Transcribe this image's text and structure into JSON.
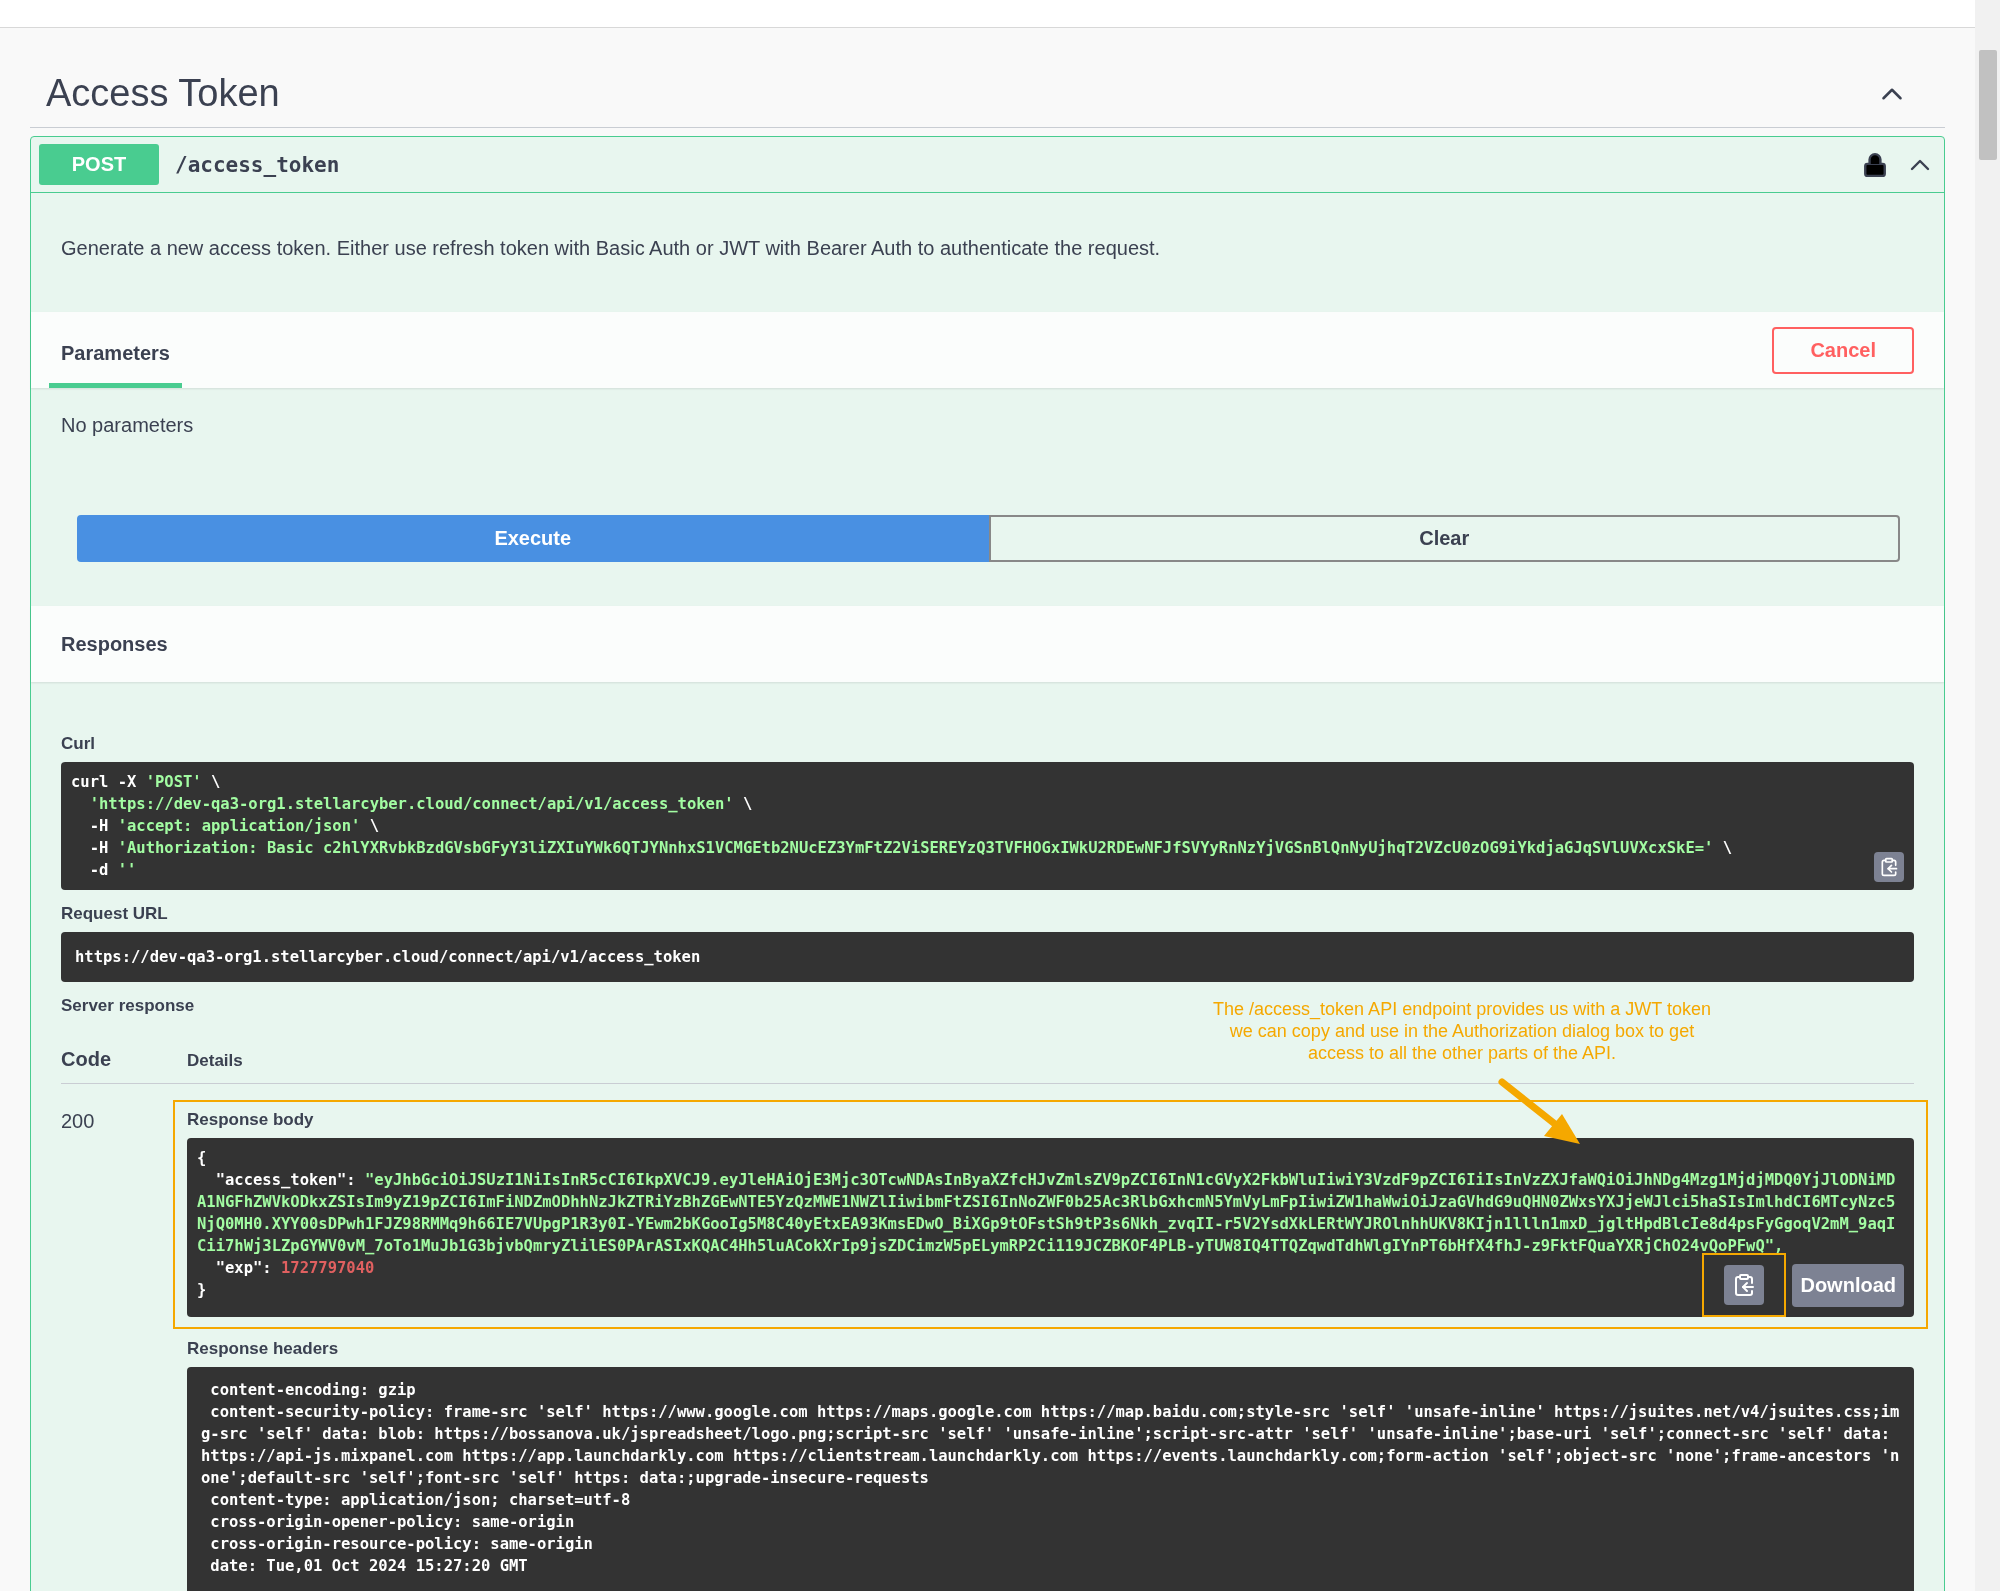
{
  "section": {
    "title": "Access Token",
    "expanded": true
  },
  "operation": {
    "method": "POST",
    "path": "/access_token",
    "locked": true,
    "expanded": true,
    "description": "Generate a new access token. Either use refresh token with Basic Auth or JWT with Bearer Auth to authenticate the request."
  },
  "parameters": {
    "tab": "Parameters",
    "tab_selected": true,
    "cancel": "Cancel",
    "empty_text": "No parameters"
  },
  "actions": [
    {
      "label": "Execute",
      "kind": "primary"
    },
    {
      "label": "Clear",
      "kind": "secondary"
    }
  ],
  "responses": {
    "title": "Responses",
    "curl_label": "Curl",
    "curl_lines": [
      "curl -X 'POST' \\",
      "  'https://dev-qa3-org1.stellarcyber.cloud/connect/api/v1/access_token' \\",
      "  -H 'accept: application/json' \\",
      "  -H 'Authorization: Basic c2hlYXRvbkBzdGVsbGFyY3liZXIuYWk6QTJYNnhxS1VCMGEtb2NUcEZ3YmFtZ2ViSEREYzQ3TVFHOGxIWkU2RDEwNFJfSVYyRnNzYjVGSnBlQnNyUjhqT2VZcU0zOG9iYkdjaGJqSVlUVXcxSkE=' \\",
      "  -d ''"
    ],
    "request_url_label": "Request URL",
    "request_url": "https://dev-qa3-org1.stellarcyber.cloud/connect/api/v1/access_token",
    "server_response_label": "Server response",
    "columns": [
      "Code",
      "Details"
    ],
    "code": "200",
    "body_label": "Response body",
    "body_lines": [
      "{",
      "  \"access_token\": \"eyJhbGciOiJSUzI1NiIsInR5cCI6IkpXVCJ9.eyJleHAiOjE3Mjc3OTcwNDAsInByaXZfcHJvZmlsZV9pZCI6InN1cGVyX2FkbWluIiwiY3VzdF9pZCI6IiIsInVzZXJfaWQiOiJhNDg4Mzg1MjdjMDQ0YjJlODNiMDA1NGFhZWVkODkxZSIsIm9yZ19pZCI6ImFiNDZmODhhNzJkZTRiYzBhZGEwNTE5YzQzMWE1NWZlIiwibmFtZSI6InNoZWF0b25Ac3RlbGxhcmN5YmVyLmFpIiwiZW1haWwiOiJzaGVhdG9uQHN0ZWxsYXJjeWJlci5haSIsImlhdCI6MTcyNzc5NjQ0MH0.XYY00sDPwh1FJZ98RMMq9h66IE7VUpgP1R3y0I-YEwm2bKGooIg5M8C40yEtxEA93KmsEDwO_BiXGp9tOFstSh9tP3s6Nkh_zvqII-r5V2YsdXkLERtWYJROlnhhUKV8KIjn1llln1mxD_jgltHpdBlcIe8d4psFyGgoqV2mM_9aqICii7hWj3LZpGYWV0vM_7oTo1MuJb1G3bjvbQmryZlilES0PArASIxKQAC4Hh5luACokXrIp9jsZDCimzW5pELymRP2Ci119JCZBKOF4PLB-yTUW8IQ4TTQZqwdTdhWlgIYnPT6bHfX4fhJ-z9FktFQuaYXRjChO24vQoPFwQ\",",
      "  \"exp\": 1727797040",
      "}"
    ],
    "download": "Download",
    "headers_label": "Response headers",
    "header_lines": [
      " content-encoding: gzip",
      " content-security-policy: frame-src 'self' https://www.google.com https://maps.google.com https://map.baidu.com;style-src 'self' 'unsafe-inline' https://jsuites.net/v4/jsuites.css;img-src 'self' data: blob: https://bossanova.uk/jspreadsheet/logo.png;script-src 'self' 'unsafe-inline';script-src-attr 'self' 'unsafe-inline';base-uri 'self';connect-src 'self' data: https://api-js.mixpanel.com https://app.launchdarkly.com https://clientstream.launchdarkly.com https://events.launchdarkly.com;form-action 'self';object-src 'none';frame-ancestors 'none';default-src 'self';font-src 'self' https: data:;upgrade-insecure-requests",
      " content-type: application/json; charset=utf-8",
      " cross-origin-opener-policy: same-origin",
      " cross-origin-resource-policy: same-origin",
      " date: Tue,01 Oct 2024 15:27:20 GMT"
    ]
  },
  "annotation": {
    "text": "The /access_token API endpoint provides us with a JWT token we can copy and use in the Authorization dialog box to get access to all the other parts of the API."
  }
}
